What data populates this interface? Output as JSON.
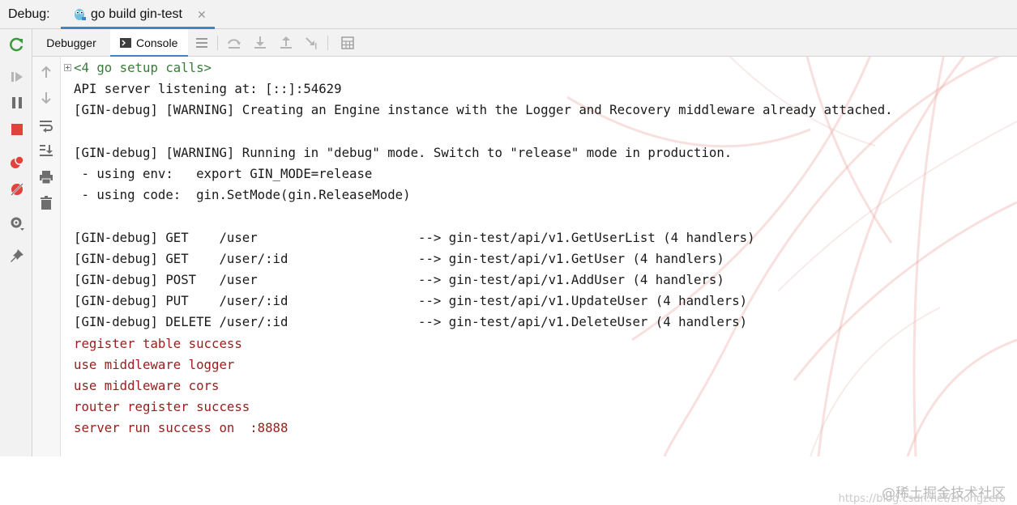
{
  "topbar": {
    "debug_label": "Debug:",
    "run_config_tab": "go build gin-test"
  },
  "subtabs": {
    "debugger": "Debugger",
    "console": "Console"
  },
  "console": {
    "setup_line": "<4 go setup calls>",
    "lines": [
      {
        "text": "API server listening at: [::]:54629",
        "kind": "normal"
      },
      {
        "text": "[GIN-debug] [WARNING] Creating an Engine instance with the Logger and Recovery middleware already attached.",
        "kind": "normal"
      },
      {
        "text": "",
        "kind": "normal"
      },
      {
        "text": "[GIN-debug] [WARNING] Running in \"debug\" mode. Switch to \"release\" mode in production.",
        "kind": "normal"
      },
      {
        "text": " - using env:   export GIN_MODE=release",
        "kind": "normal"
      },
      {
        "text": " - using code:  gin.SetMode(gin.ReleaseMode)",
        "kind": "normal"
      },
      {
        "text": "",
        "kind": "normal"
      },
      {
        "text": "[GIN-debug] GET    /user                     --> gin-test/api/v1.GetUserList (4 handlers)",
        "kind": "normal"
      },
      {
        "text": "[GIN-debug] GET    /user/:id                 --> gin-test/api/v1.GetUser (4 handlers)",
        "kind": "normal"
      },
      {
        "text": "[GIN-debug] POST   /user                     --> gin-test/api/v1.AddUser (4 handlers)",
        "kind": "normal"
      },
      {
        "text": "[GIN-debug] PUT    /user/:id                 --> gin-test/api/v1.UpdateUser (4 handlers)",
        "kind": "normal"
      },
      {
        "text": "[GIN-debug] DELETE /user/:id                 --> gin-test/api/v1.DeleteUser (4 handlers)",
        "kind": "normal"
      },
      {
        "text": "register table success",
        "kind": "app"
      },
      {
        "text": "use middleware logger",
        "kind": "app"
      },
      {
        "text": "use middleware cors",
        "kind": "app"
      },
      {
        "text": "router register success",
        "kind": "app"
      },
      {
        "text": "server run success on  :8888",
        "kind": "app"
      }
    ]
  },
  "watermark": {
    "text": "@稀土掘金技术社区",
    "url": "https://blog.csdn.net/zhongzero"
  },
  "colors": {
    "accent": "#4083c9",
    "setup_text": "#3a7a3a",
    "app_output": "#9b1c1c",
    "rerun_green": "#3c9a3c",
    "stop_red": "#e0433c"
  },
  "icons": {
    "left_toolbar": [
      "rerun-icon",
      "resume-icon",
      "pause-icon",
      "stop-icon",
      "view-breakpoints-icon",
      "mute-breakpoints-icon",
      "settings-icon",
      "pin-icon"
    ],
    "console_toolbar": [
      "scroll-up-icon",
      "scroll-down-icon",
      "soft-wrap-icon",
      "scroll-to-end-icon",
      "print-icon",
      "clear-all-icon"
    ],
    "strip": [
      "menu-icon",
      "step-over-icon",
      "step-into-icon",
      "step-out-icon",
      "run-to-cursor-icon",
      "evaluate-icon"
    ]
  }
}
